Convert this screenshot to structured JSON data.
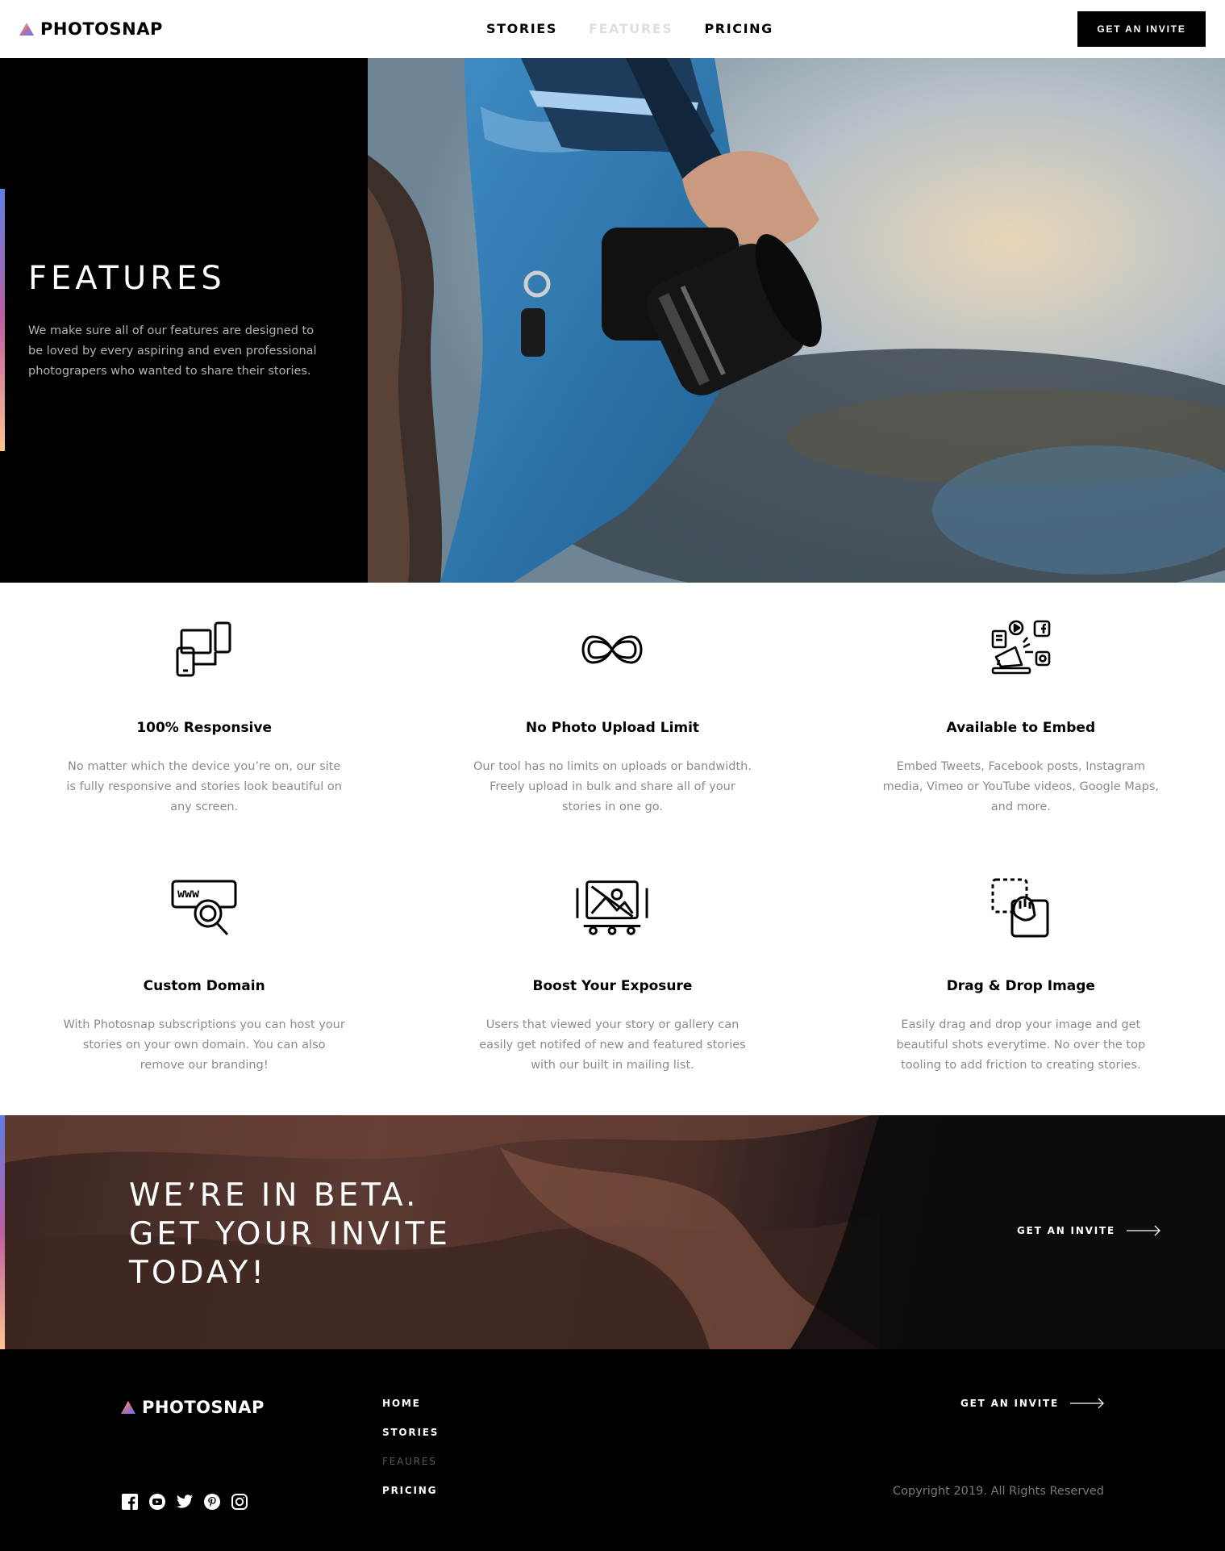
{
  "brand": {
    "name": "PHOTOSNAP"
  },
  "header": {
    "nav": [
      "STORIES",
      "FEATURES",
      "PRICING"
    ],
    "active_nav": "FEATURES",
    "cta": "GET AN INVITE"
  },
  "hero": {
    "title": "FEATURES",
    "text": "We make sure all of our features are designed to be loved by every aspiring and even professional photograpers who wanted to share their stories."
  },
  "features": [
    {
      "icon": "responsive-devices-icon",
      "title": "100% Responsive",
      "text": "No matter which the device you’re on, our site is fully responsive and stories look beautiful on any screen."
    },
    {
      "icon": "infinity-icon",
      "title": "No Photo Upload Limit",
      "text": "Our tool has no limits on uploads or bandwidth. Freely upload in bulk and share all of your stories in one go."
    },
    {
      "icon": "embed-megaphone-icon",
      "title": "Available to Embed",
      "text": "Embed Tweets, Facebook posts, Instagram media, Vimeo or YouTube videos, Google Maps, and more."
    },
    {
      "icon": "www-search-icon",
      "title": "Custom Domain",
      "text": "With Photosnap subscriptions you can host your stories on your own domain. You can also remove our branding!"
    },
    {
      "icon": "image-boost-icon",
      "title": "Boost Your Exposure",
      "text": "Users that viewed your story or gallery can easily get notifed of new and featured stories with our built in mailing list."
    },
    {
      "icon": "drag-drop-icon",
      "title": "Drag & Drop Image",
      "text": "Easily drag and drop your image and get beautiful shots everytime. No over the top tooling to add friction to creating stories."
    }
  ],
  "beta": {
    "title": "WE’RE IN BETA. GET YOUR INVITE TODAY!",
    "cta": "GET AN INVITE"
  },
  "footer": {
    "nav": [
      "HOME",
      "STORIES",
      "FEAURES",
      "PRICING"
    ],
    "cta": "GET AN INVITE",
    "copyright": "Copyright 2019. All Rights Reserved",
    "social": [
      "facebook-icon",
      "youtube-icon",
      "twitter-icon",
      "pinterest-icon",
      "instagram-icon"
    ]
  }
}
